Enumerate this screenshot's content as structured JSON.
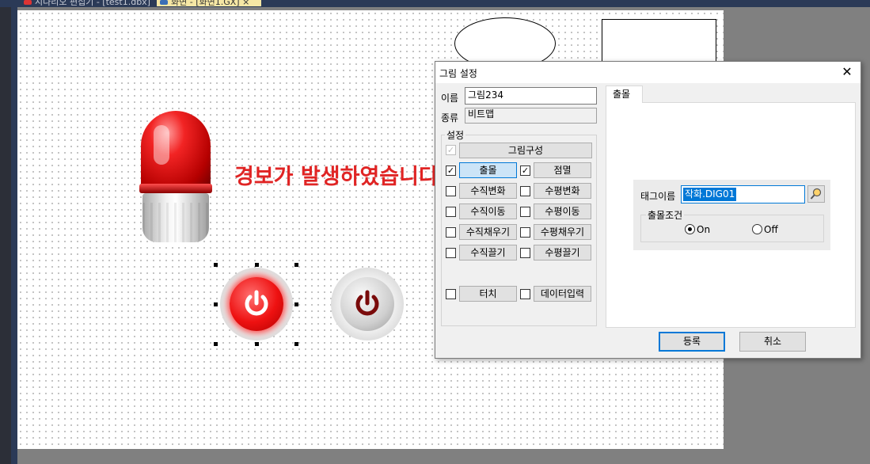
{
  "document_tabs": [
    {
      "label": "시나리오 편집기 - [test1.dbx]"
    },
    {
      "label": "화면 - [화면1.GX] ×"
    }
  ],
  "canvas": {
    "alarm_text": "경보가 발생하였습니다"
  },
  "dialog": {
    "title": "그림 설정",
    "close_label": "✕",
    "name_label": "이름",
    "name_value": "그림234",
    "type_label": "종류",
    "type_value": "비트맵",
    "settings_group": "설정",
    "compose_button": "그림구성",
    "options": [
      {
        "label": "출몰",
        "checked": true
      },
      {
        "label": "점멸",
        "checked": true
      },
      {
        "label": "수직변화",
        "checked": false
      },
      {
        "label": "수평변화",
        "checked": false
      },
      {
        "label": "수직이동",
        "checked": false
      },
      {
        "label": "수평이동",
        "checked": false
      },
      {
        "label": "수직채우기",
        "checked": false
      },
      {
        "label": "수평채우기",
        "checked": false
      },
      {
        "label": "수직끌기",
        "checked": false
      },
      {
        "label": "수평끌기",
        "checked": false
      },
      {
        "label": "터치",
        "checked": false
      },
      {
        "label": "데이터입력",
        "checked": false
      }
    ],
    "active_tab": "출몰",
    "tag_label": "태그이름",
    "tag_value": "작화.DIG01",
    "condition_group": "출몰조건",
    "condition_options": [
      "On",
      "Off"
    ],
    "condition_selected": "On",
    "ok_button": "등록",
    "cancel_button": "취소"
  },
  "colors": {
    "alarm_text": "#e02424",
    "accent": "#0078d7",
    "tab_strip": "#2b3a57"
  }
}
